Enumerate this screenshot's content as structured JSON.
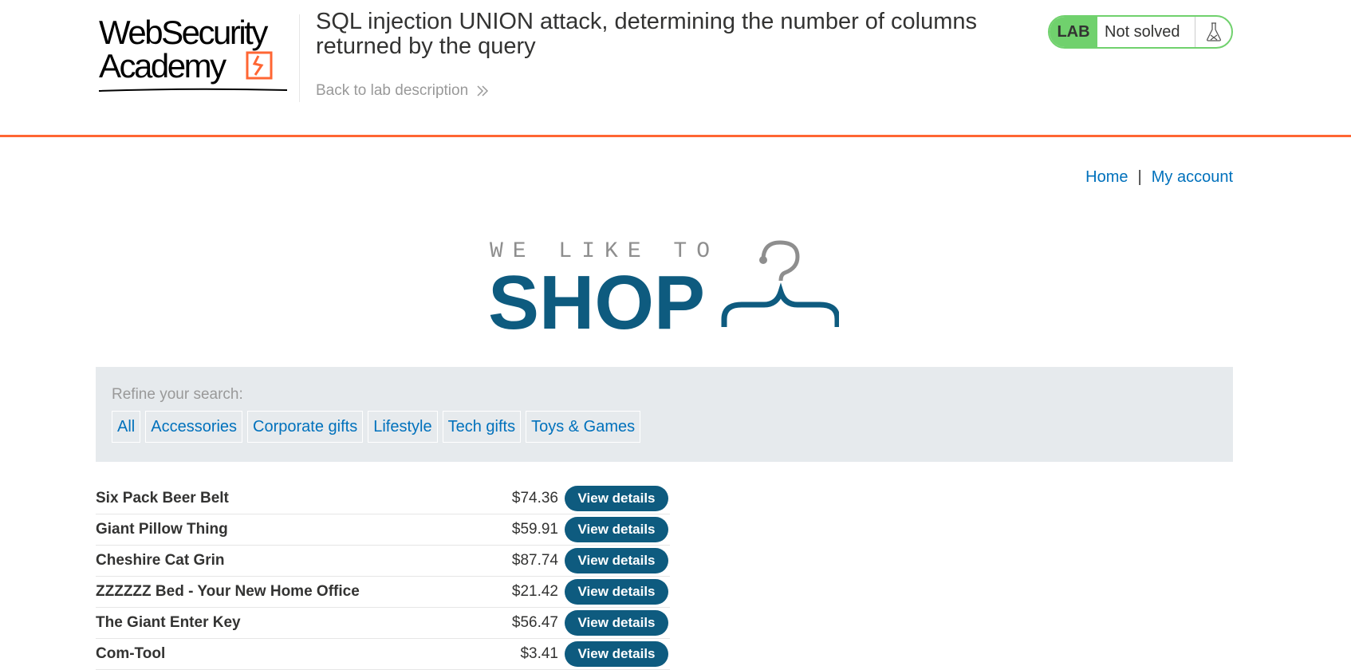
{
  "header": {
    "logo_line1": "WebSecurity",
    "logo_line2": "Academy",
    "lab_title": "SQL injection UNION attack, determining the number of columns returned by the query",
    "back_link": "Back to lab description",
    "status_lab": "LAB",
    "status_text": "Not solved",
    "accent_color": "#ff6633",
    "status_color": "#70d16d"
  },
  "nav": {
    "home": "Home",
    "separator": "|",
    "account": "My account"
  },
  "shop_logo": {
    "tagline": "WE LIKE TO",
    "word": "SHOP",
    "brand_color": "#0e5b7f"
  },
  "refine": {
    "label": "Refine your search:",
    "filters": [
      "All",
      "Accessories",
      "Corporate gifts",
      "Lifestyle",
      "Tech gifts",
      "Toys & Games"
    ]
  },
  "products": {
    "button_label": "View details",
    "items": [
      {
        "name": "Six Pack Beer Belt",
        "price": "$74.36"
      },
      {
        "name": "Giant Pillow Thing",
        "price": "$59.91"
      },
      {
        "name": "Cheshire Cat Grin",
        "price": "$87.74"
      },
      {
        "name": "ZZZZZZ Bed - Your New Home Office",
        "price": "$21.42"
      },
      {
        "name": "The Giant Enter Key",
        "price": "$56.47"
      },
      {
        "name": "Com-Tool",
        "price": "$3.41"
      }
    ]
  }
}
